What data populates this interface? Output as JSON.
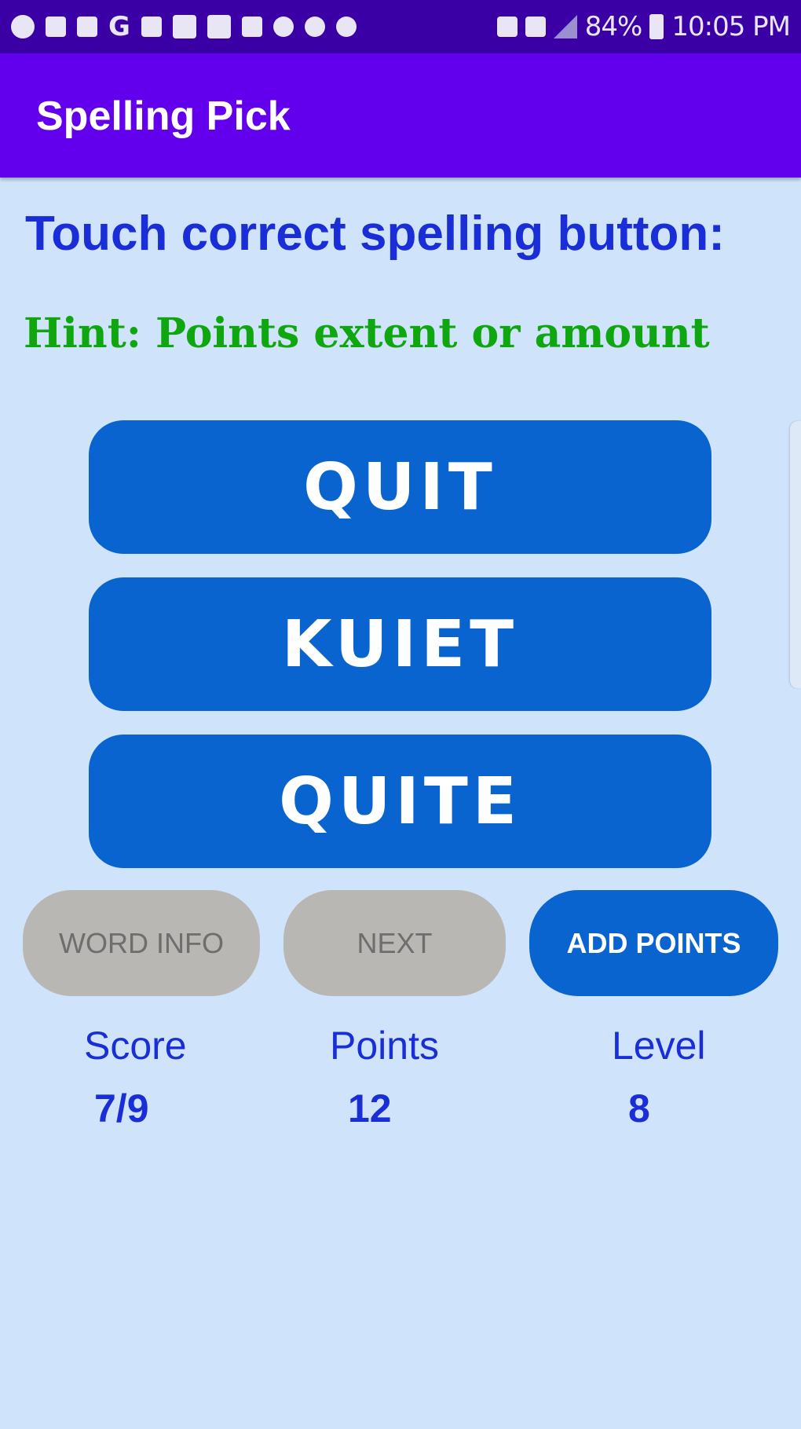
{
  "status_bar": {
    "carrier_letter": "G",
    "battery_percent": "84%",
    "time": "10:05 PM",
    "color": "#3a00a6"
  },
  "app_bar": {
    "title": "Spelling Pick",
    "color": "#6200ee"
  },
  "instruction": "Touch correct spelling button:",
  "hint": "Hint: Points extent or amount",
  "choices": [
    {
      "label": "QUIT"
    },
    {
      "label": "KUIET"
    },
    {
      "label": "QUITE"
    }
  ],
  "actions": {
    "word_info": {
      "label": "WORD INFO",
      "enabled": false
    },
    "next": {
      "label": "NEXT",
      "enabled": false
    },
    "add_points": {
      "label": "ADD POINTS",
      "enabled": true
    }
  },
  "stats": {
    "score_label": "Score",
    "score_value": "7/9",
    "points_label": "Points",
    "points_value": "12",
    "level_label": "Level",
    "level_value": "8"
  },
  "colors": {
    "background": "#cfe4fb",
    "button_blue": "#0a64d0",
    "text_blue": "#1a2ed8",
    "hint_green": "#0fa60f",
    "disabled_gray": "#b9b7b4"
  }
}
